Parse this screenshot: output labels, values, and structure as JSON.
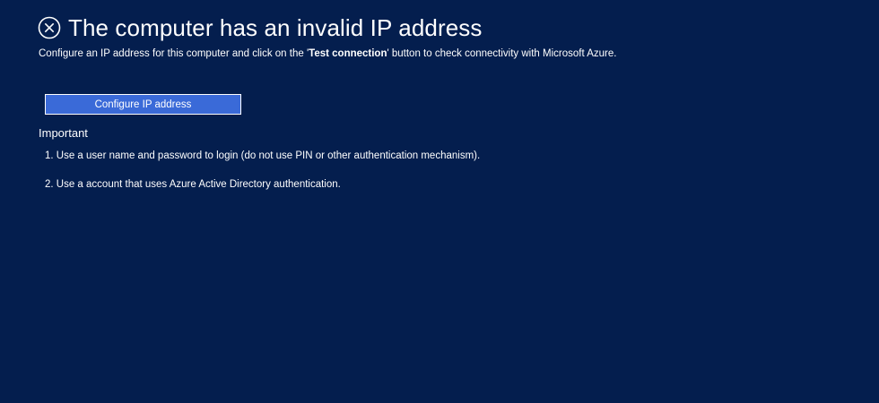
{
  "header": {
    "icon": "error-circle-x-icon",
    "title": "The computer has an invalid IP address",
    "subtitle_before": "Configure an IP address for this computer and click on the '",
    "subtitle_bold": "Test connection",
    "subtitle_after": "' button to check connectivity with Microsoft Azure."
  },
  "actions": {
    "configure_ip_label": "Configure IP address"
  },
  "important": {
    "heading": "Important",
    "items": [
      "1. Use a user name and password to login (do not use PIN or other authentication mechanism).",
      "2. Use a account that uses Azure Active Directory authentication."
    ]
  },
  "colors": {
    "background": "#041e4e",
    "button": "#3a6ad8",
    "text": "#ffffff"
  }
}
